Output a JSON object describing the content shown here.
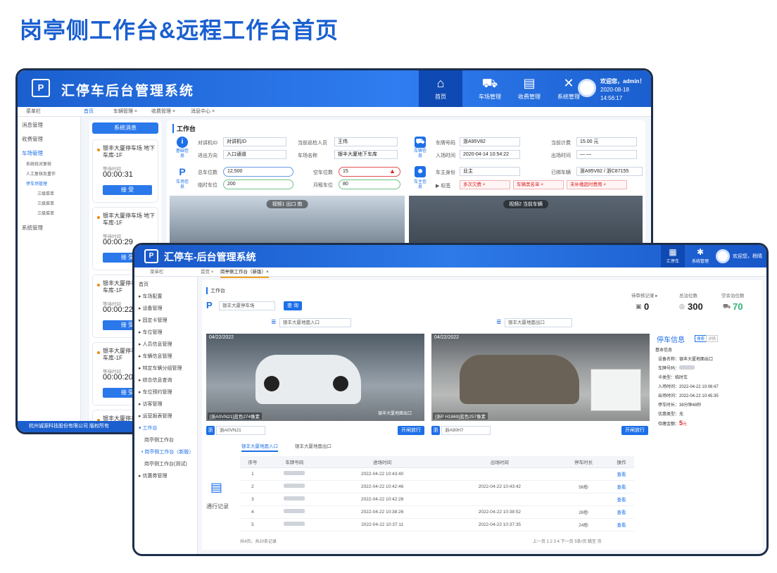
{
  "title": "岗亭侧工作台&远程工作台首页",
  "back": {
    "logo": "P",
    "app_title": "汇停车后台管理系统",
    "nav": [
      {
        "label": "首页",
        "icon": "home-icon",
        "glyph": "⌂"
      },
      {
        "label": "车场管理",
        "icon": "car-icon",
        "glyph": "⛟"
      },
      {
        "label": "收费管理",
        "icon": "doc-icon",
        "glyph": "▤"
      },
      {
        "label": "系统管理",
        "icon": "tools-icon",
        "glyph": "✕"
      }
    ],
    "user_greeting": "欢迎您，admin！",
    "user_time": "2020-08-18 14:56:17",
    "tabs": [
      "菜单栏",
      "首页",
      "车辆管理 ×",
      "收费管理 ×",
      "消息中心 ×"
    ],
    "sidebar": [
      "消息管理",
      "收费管理",
      "车场管理",
      "系统校对复核",
      "人工复核及重作",
      "停车场管理",
      "三级菜单",
      "三级菜单",
      "三级菜单",
      "系统管理"
    ],
    "footer": "杭州诚源科技股份有限公司 版权所有",
    "msg_title": "系统消息",
    "cards": [
      {
        "loc": "银丰大厦停车场 地下车库-1F",
        "wait_label": "等待时间",
        "wait": "00:00:31",
        "btn": "接 受"
      },
      {
        "loc": "银丰大厦停车场 地下车库-1F",
        "wait_label": "等待时间",
        "wait": "00:00:29",
        "btn": "接 受"
      },
      {
        "loc": "银丰大厦停车场 地下车库-1F",
        "wait_label": "等待时间",
        "wait": "00:00:22",
        "btn": "接 受"
      },
      {
        "loc": "银丰大厦停车场 地下车库-1F",
        "wait_label": "等待时间",
        "wait": "00:00:20",
        "btn": "接 受"
      },
      {
        "loc": "银丰大厦停车场 地下车库-1F",
        "wait_label": "",
        "wait": "",
        "btn": ""
      }
    ],
    "work_title": "工作台",
    "basic": {
      "caption": "基础信息",
      "f1l": "对讲机ID",
      "f1v": "对讲机ID",
      "f2l": "当前巡检人员",
      "f2v": "王伟",
      "f3l": "进出方向",
      "f3v": "入口通道",
      "f4l": "车场名称",
      "f4v": "银丰大厦地下车库"
    },
    "vehicle": {
      "caption": "车辆信息",
      "f1l": "车牌号码",
      "f1v": "浙A95V82",
      "f2l": "当前计费",
      "f2v": "15.00 元",
      "f3l": "入场时间",
      "f3v": "2020-04-14  10:54:22",
      "f4l": "出场时间",
      "f4v": "— —"
    },
    "lot": {
      "caption": "车场信息",
      "f1l": "总车位数",
      "f1v": "12,500",
      "f2l": "空车位数",
      "f2v": "15",
      "f3l": "临时车位",
      "f3v": "200",
      "f4l": "月租车位",
      "f4v": "80"
    },
    "owner": {
      "caption": "车主信息",
      "f1l": "车主身份",
      "f1v": "业主",
      "f2l": "已绑车辆",
      "f2v": "浙A95V82 / 浙C87155",
      "tagl": "标签",
      "tags": [
        "多次欠费 ×",
        "车辆黑名单 ×",
        "未补缴超时费用 ×"
      ]
    },
    "video1": "视频1  出口 南",
    "video2": "视频2  当前车辆"
  },
  "front": {
    "logo": "P",
    "app_title": "汇停车-后台管理系统",
    "nav": [
      {
        "label": "汇停车"
      },
      {
        "label": "系统管理"
      }
    ],
    "user": "欢迎您，杨晴",
    "tabs": [
      "菜单栏",
      "首页 ×",
      "岗亭侧工作台（新版）×"
    ],
    "sidebar": [
      "首页",
      "车场配置",
      "设备管理",
      "固定卡管理",
      "车位管理",
      "人员信息管理",
      "车辆信息管理",
      "特定车辆分组管理",
      "综合信息查询",
      "车位预约管理",
      "访客管理",
      "运营报表管理",
      "工作台",
      "岗亭侧工作台",
      "• 岗亭侧工作台（新版）",
      "岗亭侧工作台(测试)",
      "优惠券管理"
    ],
    "work_title": "工作台",
    "lot_select": "银丰大厦停车场",
    "query_btn": "查 询",
    "stats": [
      {
        "label": "待审核记录 ▸",
        "value": "0",
        "icon": "doc-icon",
        "glyph": "▣"
      },
      {
        "label": "总泊位数",
        "value": "300",
        "icon": "pin-icon",
        "glyph": "◎"
      },
      {
        "label": "空余泊位数",
        "value": "70",
        "icon": "car-icon",
        "glyph": "⛟"
      }
    ],
    "entry_select": "银丰大厦地面入口",
    "exit_select": "银丰大厦地面出口",
    "cam1": {
      "date": "04/22/2022",
      "plate": "[浙A0VN21]蓝色274像素",
      "loc": "银丰大厦地面出口"
    },
    "cam2": {
      "date": "04/22/2022",
      "plate": "[浙P H1869]蓝色257像素"
    },
    "info_title": "停车信息",
    "info_tabs": [
      "搜索",
      "详情"
    ],
    "info": [
      "基本信息",
      "设备名称：银丰大厦地面出口",
      "车牌号码：",
      "卡类型：临时车",
      "入场时间：2022-04-22 10:06:47",
      "出场时间：2022-04-22 10:45:35",
      "停车时长：38分钟48秒",
      "优惠类型：无",
      "待缴金额："
    ],
    "due_amount": "5",
    "due_unit": "元",
    "plate_in": "浙A0VN21",
    "plate_out": "浙A90H7",
    "plate_prefix": "浙",
    "open_btn": "开闸放行",
    "record_tabs": [
      "银丰大厦地面入口",
      "银丰大厦地面出口"
    ],
    "record_label": "通行记录",
    "table_headers": [
      "序号",
      "车牌号码",
      "进场时间",
      "出场时间",
      "停车时长",
      "操作"
    ],
    "rows": [
      {
        "n": "1",
        "in": "2022-04-22 10:43:40",
        "out": "",
        "dur": "",
        "op": "查看"
      },
      {
        "n": "2",
        "in": "2022-04-22 10:42:46",
        "out": "2022-04-22 10:43:42",
        "dur": "56秒",
        "op": "查看"
      },
      {
        "n": "3",
        "in": "2022-04-22 10:42:28",
        "out": "",
        "dur": "",
        "op": "查看"
      },
      {
        "n": "4",
        "in": "2022-04-22 10:38:26",
        "out": "2022-04-22 10:38:52",
        "dur": "26秒",
        "op": "查看"
      },
      {
        "n": "5",
        "in": "2022-04-22 10:37:11",
        "out": "2022-04-22 10:37:35",
        "dur": "24秒",
        "op": "查看"
      }
    ],
    "pagination_left": "共4页，共20条记录",
    "pagination_right": "上一页  1  2  3  4  下一页  5条/页  跳至      页"
  }
}
